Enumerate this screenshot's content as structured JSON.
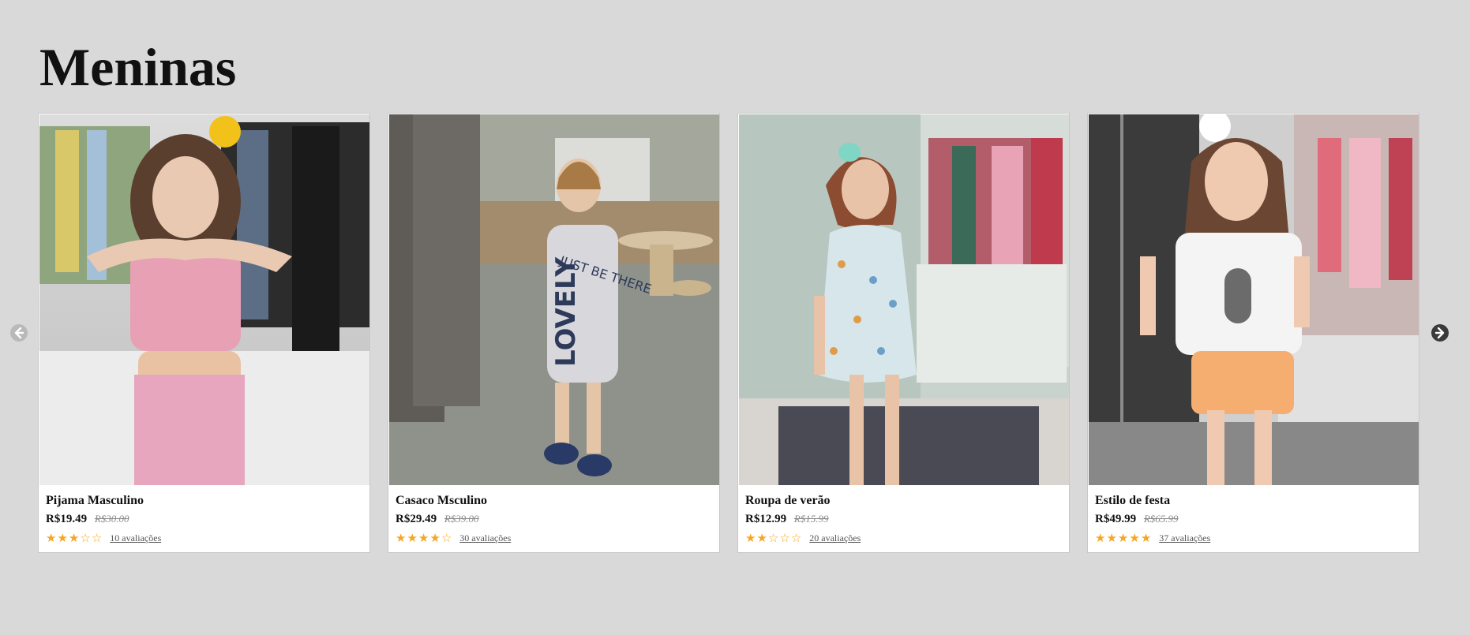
{
  "page": {
    "title": "Meninas"
  },
  "carousel": {
    "prev_icon": "arrow-left-circle-icon",
    "next_icon": "arrow-right-circle-icon",
    "products": [
      {
        "name": "Pijama Masculino",
        "price": "R$19.49",
        "old_price": "R$30.00",
        "rating": 3,
        "reviews": "10 avaliações",
        "image_icon": "product-photo"
      },
      {
        "name": "Casaco Msculino",
        "price": "R$29.49",
        "old_price": "R$39.00",
        "rating": 4,
        "reviews": "30 avaliações",
        "image_icon": "product-photo"
      },
      {
        "name": "Roupa de verão",
        "price": "R$12.99",
        "old_price": "R$15.99",
        "rating": 2,
        "reviews": "20 avaliações",
        "image_icon": "product-photo"
      },
      {
        "name": "Estilo de festa",
        "price": "R$49.99",
        "old_price": "R$65.99",
        "rating": 5,
        "reviews": "37 avaliações",
        "image_icon": "product-photo"
      }
    ]
  },
  "colors": {
    "background": "#d9d9d9",
    "star": "#f5a623",
    "card": "#ffffff"
  }
}
